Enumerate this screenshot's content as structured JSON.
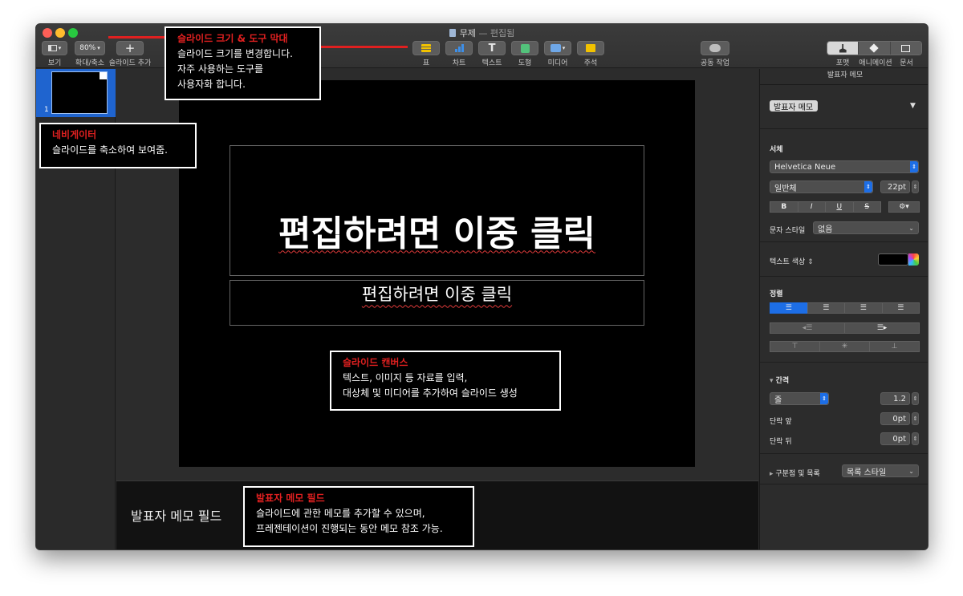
{
  "window": {
    "title": "무제",
    "title_suffix": "— 편집됨"
  },
  "toolbar": {
    "view_label": "보기",
    "zoom_value": "80%",
    "zoom_label": "확대/축소",
    "add_slide_label": "슬라이드 추가",
    "table_label": "표",
    "chart_label": "차트",
    "text_label": "텍스트",
    "shape_label": "도형",
    "media_label": "미디어",
    "comment_label": "주석",
    "collab_label": "공동 작업",
    "format_label": "포맷",
    "animate_label": "애니메이션",
    "document_label": "문서"
  },
  "navigator": {
    "slide_number": "1"
  },
  "slide": {
    "title_placeholder": "편집하려면 이중 클릭",
    "body_placeholder": "편집하려면 이중 클릭"
  },
  "notes": {
    "text": "발표자 메모 필드"
  },
  "inspector": {
    "header": "발표자 메모",
    "style_name": "발표자 메모",
    "font_section": "서체",
    "font_family": "Helvetica Neue",
    "font_style": "일반체",
    "font_size": "22pt",
    "bold": "B",
    "italic": "I",
    "underline": "U",
    "strike": "S",
    "char_style_label": "문자 스타일",
    "char_style_value": "없음",
    "text_color_label": "텍스트 색상",
    "align_section": "정렬",
    "spacing_section": "간격",
    "spacing_type": "줄",
    "spacing_value": "1.2",
    "before_label": "단락 앞",
    "before_value": "0pt",
    "after_label": "단락 뒤",
    "after_value": "0pt",
    "bullets_label": "구분점 및 목록",
    "bullets_value": "목록 스타일"
  },
  "callouts": {
    "toolbar": {
      "title": "슬라이드 크기 & 도구 막대",
      "line1": "슬라이드 크기를 변경합니다.",
      "line2": "자주 사용하는 도구를",
      "line3": "사용자화 합니다."
    },
    "navigator": {
      "title": "네비게이터",
      "line1": "슬라이드를 축소하여 보여줌."
    },
    "canvas": {
      "title": "슬라이드 캔버스",
      "line1": "텍스트, 이미지 등 자료를 입력,",
      "line2": "대상체 및 미디어를 추가하여 슬라이드 생성"
    },
    "notes": {
      "title": "발표자 메모 필드",
      "line1": "슬라이드에 관한 메모를 추가할 수 있으며,",
      "line2": "프레젠테이션이 진행되는 동안 메모 참조 가능."
    }
  },
  "colors": {
    "accent": "#1d6ee6",
    "callout_title": "#e02020"
  }
}
